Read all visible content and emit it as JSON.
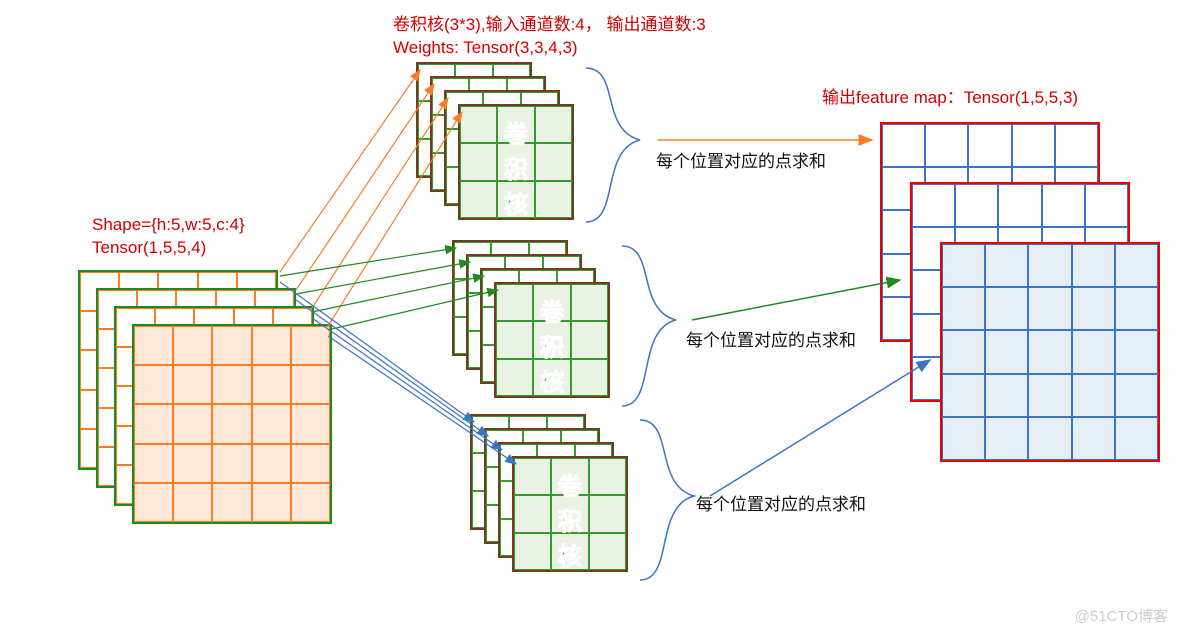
{
  "diagram": {
    "input": {
      "shape_label": "Shape={h:5,w:5,c:4}",
      "tensor_label": "Tensor(1,5,5,4)",
      "grid_size": 5,
      "channels": 4
    },
    "kernel": {
      "title_line1": "卷积核(3*3),输入通道数:4， 输出通道数:3",
      "title_line2": "Weights: Tensor(3,3,4,3)",
      "grid_size": 3,
      "input_channels": 4,
      "output_channels": 3,
      "label_text": "卷积核"
    },
    "output": {
      "title": "输出feature map：Tensor(1,5,5,3)",
      "grid_size": 5,
      "channels": 3
    },
    "arrow_label": "每个位置对应的点求和",
    "colors": {
      "orange": "#ff7b24",
      "green": "#1f8a1f",
      "blue": "#3a74c5",
      "red": "#ea0000",
      "brown": "#6d3f1f"
    }
  },
  "watermark": "@51CTO博客"
}
